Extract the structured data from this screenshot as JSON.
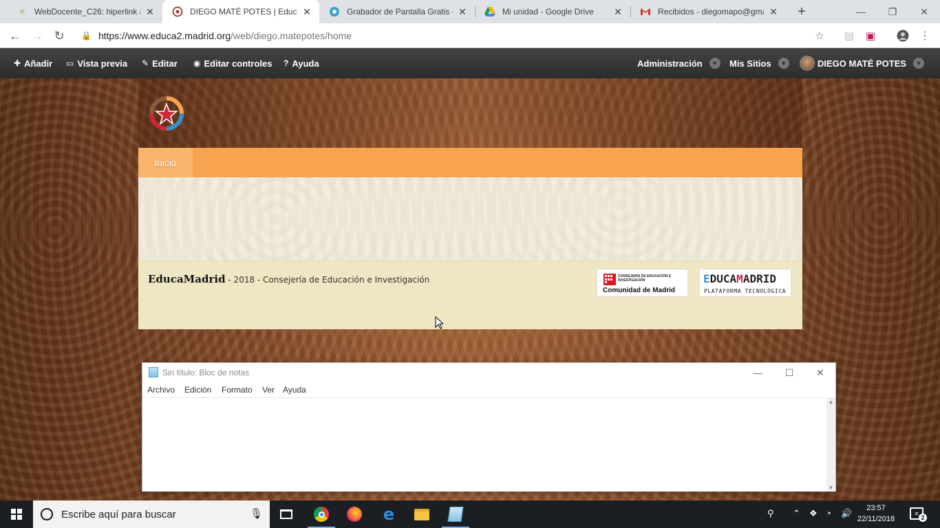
{
  "browser": {
    "tabs": [
      {
        "title": "WebDocente_C26: hiperlink ab",
        "icon": "leaf-icon",
        "active": false
      },
      {
        "title": "DIEGO MATÉ POTES | EducaM",
        "icon": "educamadrid-icon",
        "active": true
      },
      {
        "title": "Grabador de Pantalla Gratis – ",
        "icon": "screen-recorder-icon",
        "active": false
      },
      {
        "title": "Mi unidad - Google Drive",
        "icon": "google-drive-icon",
        "active": false
      },
      {
        "title": "Recibidos - diegomapo@gma",
        "icon": "gmail-icon",
        "active": false
      }
    ],
    "url_host": "https://www.educa2.madrid.org",
    "url_path": "/web/diego.matepotes/home"
  },
  "dock": {
    "add": "Añadir",
    "preview": "Vista previa",
    "edit": "Editar",
    "edit_controls": "Editar controles",
    "help": "Ayuda",
    "admin": "Administración",
    "my_sites": "Mis Sitios",
    "user": "DIEGO MATÉ POTES"
  },
  "site": {
    "nav": [
      "Inicio"
    ],
    "footer": {
      "brand": "EducaMadrid",
      "text": " - 2018 - Consejería de Educación e Investigación",
      "cm_small": "CONSEJERÍA DE EDUCACIÓN E INVESTIGACIÓN",
      "cm_big": "Comunidad de Madrid",
      "em_big_1": "E",
      "em_big_2": "DUCA",
      "em_big_3": "M",
      "em_big_4": "ADRID",
      "em_small": "PLATAFORMA TECNOLÓGICA"
    }
  },
  "notepad": {
    "title": "Sin título: Bloc de notas",
    "menu": [
      "Archivo",
      "Edición",
      "Formato",
      "Ver",
      "Ayuda"
    ],
    "content": ""
  },
  "taskbar": {
    "search_placeholder": "Escribe aquí para buscar",
    "time": "23:57",
    "date": "22/11/2018",
    "notifications": "2"
  },
  "colors": {
    "nav_orange": "#f7a34f",
    "dock_bg": "#2c2c2c",
    "footer_bg": "#efe6c3"
  }
}
